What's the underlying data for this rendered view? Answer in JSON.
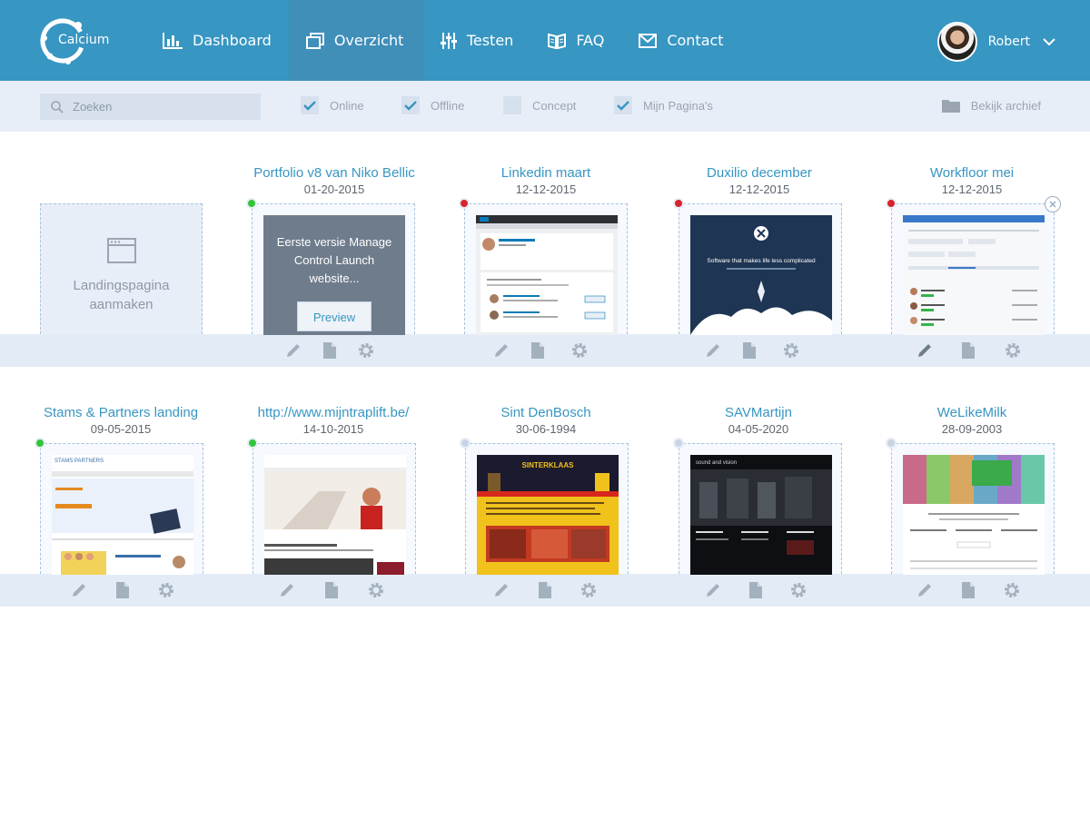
{
  "brand": {
    "name": "Calcium"
  },
  "nav": [
    {
      "label": "Dashboard",
      "icon": "bar-chart-icon",
      "active": false
    },
    {
      "label": "Overzicht",
      "icon": "overview-icon",
      "active": true
    },
    {
      "label": "Testen",
      "icon": "sliders-icon",
      "active": false
    },
    {
      "label": "FAQ",
      "icon": "book-icon",
      "active": false
    },
    {
      "label": "Contact",
      "icon": "envelope-icon",
      "active": false
    }
  ],
  "user": {
    "name": "Robert"
  },
  "filters": {
    "search_placeholder": "Zoeken",
    "online": {
      "label": "Online",
      "checked": true
    },
    "offline": {
      "label": "Offline",
      "checked": true
    },
    "concept": {
      "label": "Concept",
      "checked": false
    },
    "mine": {
      "label": "Mijn Pagina's",
      "checked": true
    },
    "archive_label": "Bekijk archief"
  },
  "new_page": {
    "label_line1": "Landingspagina",
    "label_line2": "aanmaken"
  },
  "overlay": {
    "description": "Eerste versie Manage Control Launch website...",
    "preview_label": "Preview"
  },
  "cards": [
    {
      "title": "Portfolio v8 van Niko Bellic",
      "date": "01-20-2015",
      "status": "online"
    },
    {
      "title": "Linkedin maart",
      "date": "12-12-2015",
      "status": "offline"
    },
    {
      "title": "Duxilio december",
      "date": "12-12-2015",
      "status": "offline"
    },
    {
      "title": "Workfloor mei",
      "date": "12-12-2015",
      "status": "offline"
    },
    {
      "title": "Stams & Partners landing",
      "date": "09-05-2015",
      "status": "online"
    },
    {
      "title": "http://www.mijntraplift.be/",
      "date": "14-10-2015",
      "status": "online"
    },
    {
      "title": "Sint DenBosch",
      "date": "30-06-1994",
      "status": "concept"
    },
    {
      "title": "SAVMartijn",
      "date": "04-05-2020",
      "status": "concept"
    },
    {
      "title": "WeLikeMilk",
      "date": "28-09-2003",
      "status": "concept"
    }
  ],
  "thumb_text": {
    "duxilio": "Software that makes life less complicated",
    "stams": "STAMS PARTNERS",
    "sint": "SINTERKLAAS",
    "sound": "sound and vision"
  },
  "colors": {
    "header": "#3796c2",
    "accent": "#3796c2",
    "online": "#34c43a",
    "offline": "#d8232e"
  }
}
